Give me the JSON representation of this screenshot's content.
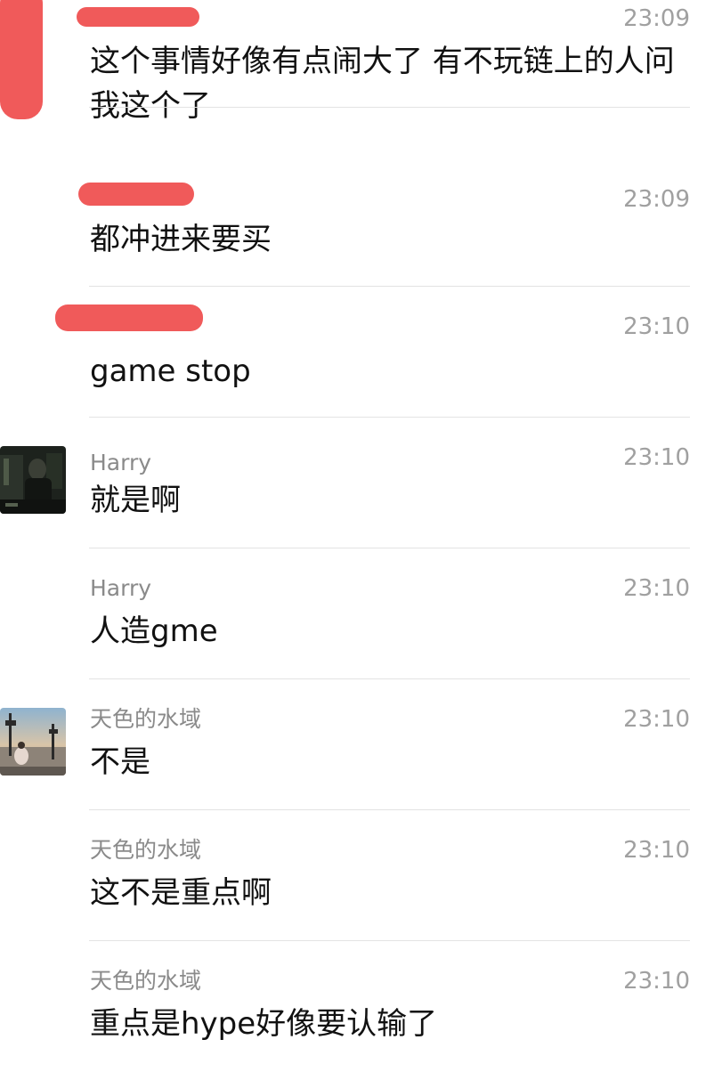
{
  "messages": [
    {
      "sender": "",
      "time": "23:09",
      "text": "这个事情好像有点闹大了 有不玩链上的人问我这个了"
    },
    {
      "sender": "",
      "time": "23:09",
      "text": "都冲进来要买"
    },
    {
      "sender": "",
      "time": "23:10",
      "text": "game stop"
    },
    {
      "sender": "Harry",
      "time": "23:10",
      "text": "就是啊"
    },
    {
      "sender": "Harry",
      "time": "23:10",
      "text": "人造gme"
    },
    {
      "sender": "天色的水域",
      "time": "23:10",
      "text": "不是"
    },
    {
      "sender": "天色的水域",
      "time": "23:10",
      "text": "这不是重点啊"
    },
    {
      "sender": "天色的水域",
      "time": "23:10",
      "text": "重点是hype好像要认输了"
    }
  ],
  "colors": {
    "redaction": "#f05a5a",
    "divider": "#e3e3e3",
    "sender_text": "#8a8a8a",
    "time_text": "#a0a0a0"
  }
}
